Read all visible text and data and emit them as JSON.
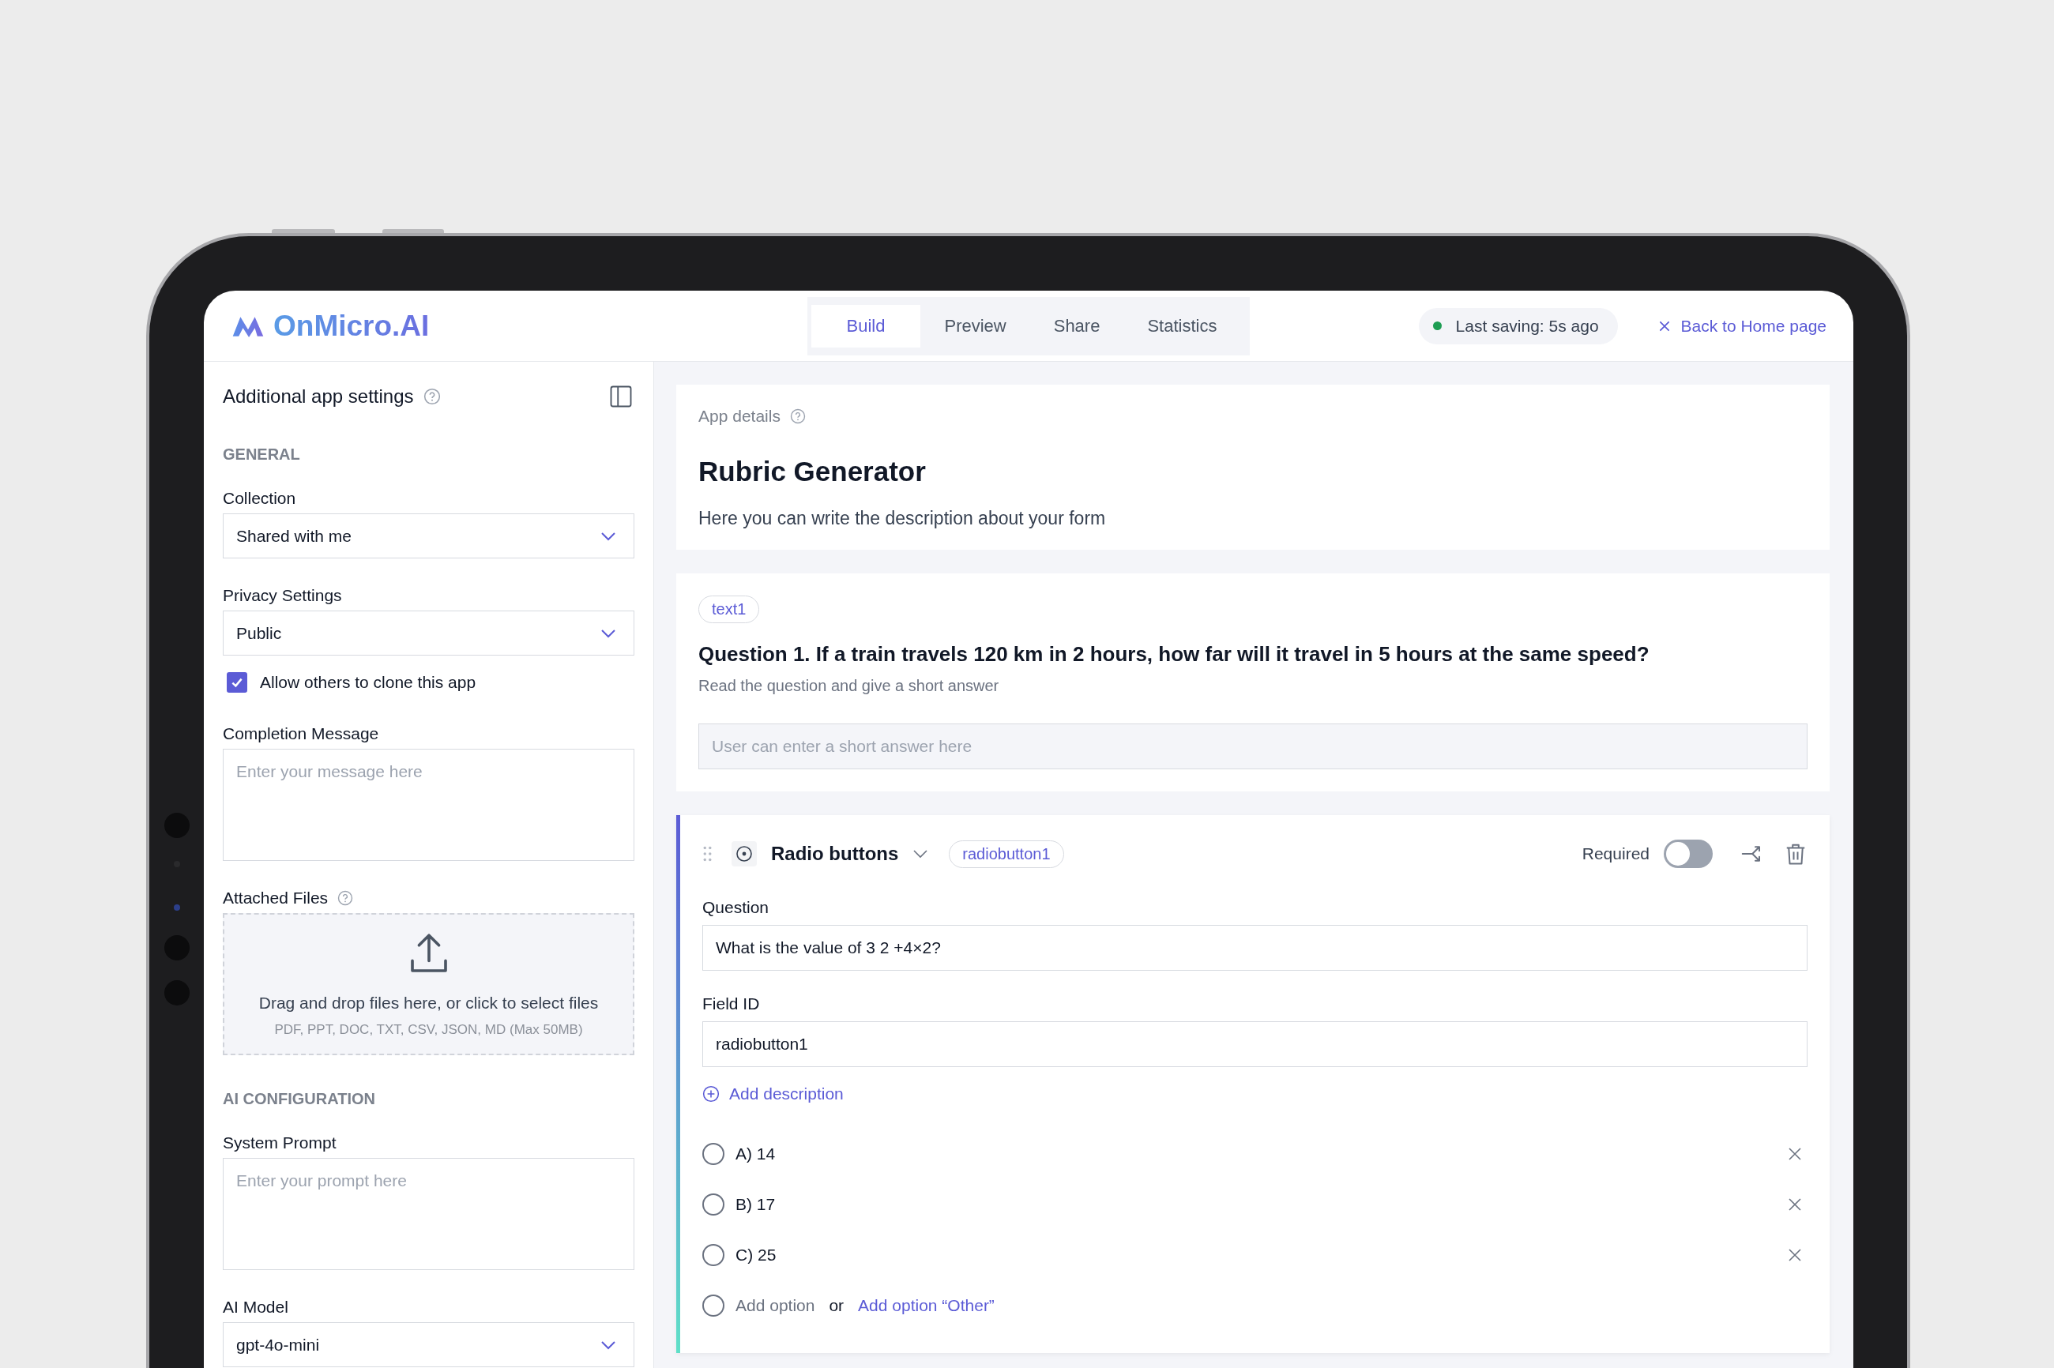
{
  "header": {
    "logo": "OnMicro.AI",
    "tabs": [
      {
        "label": "Build",
        "selected": true
      },
      {
        "label": "Preview",
        "selected": false
      },
      {
        "label": "Share",
        "selected": false
      },
      {
        "label": "Statistics",
        "selected": false
      }
    ],
    "save_status": "Last saving: 5s ago",
    "back_link": "Back to Home page"
  },
  "sidebar": {
    "title": "Additional app settings",
    "sections": [
      {
        "heading": "GENERAL",
        "fields": [
          {
            "kind": "select",
            "label": "Collection",
            "value": "Shared with me"
          },
          {
            "kind": "select",
            "label": "Privacy Settings",
            "value": "Public"
          },
          {
            "kind": "checkbox",
            "label": "Allow others to clone this app",
            "checked": true
          },
          {
            "kind": "textarea",
            "label": "Completion Message",
            "placeholder": "Enter your message here"
          },
          {
            "kind": "upload",
            "label": "Attached Files",
            "prompt": "Drag and drop files here, or click to select files",
            "formats": "PDF, PPT, DOC, TXT, CSV, JSON, MD (Max 50MB)"
          }
        ]
      },
      {
        "heading": "AI CONFIGURATION",
        "fields": [
          {
            "kind": "textarea",
            "label": "System Prompt",
            "placeholder": "Enter your prompt here"
          },
          {
            "kind": "select",
            "label": "AI Model",
            "value": "gpt-4o-mini"
          }
        ]
      }
    ]
  },
  "app_details": {
    "label": "App details",
    "title": "Rubric Generator",
    "description": "Here you can write the description about your form"
  },
  "questions": [
    {
      "kind": "short_text",
      "chip": "text1",
      "question": "Question 1. If a train travels 120 km in 2 hours, how far will it travel in 5 hours at the same speed?",
      "hint": "Read the question and give a short answer",
      "placeholder": "User can enter a short answer here"
    },
    {
      "kind": "radio",
      "type_label": "Radio buttons",
      "chip": "radiobutton1",
      "required_label": "Required",
      "required": false,
      "question_label": "Question",
      "question": "What is the value of 3 2 +4×2?",
      "field_id_label": "Field ID",
      "field_id": "radiobutton1",
      "add_description": "Add description",
      "options": [
        {
          "label": "A) 14",
          "selected": false
        },
        {
          "label": "B) 17",
          "selected": false
        },
        {
          "label": "C) 25",
          "selected": false
        }
      ],
      "add_option": "Add option",
      "or": "or",
      "add_other": "Add option “Other”"
    }
  ]
}
